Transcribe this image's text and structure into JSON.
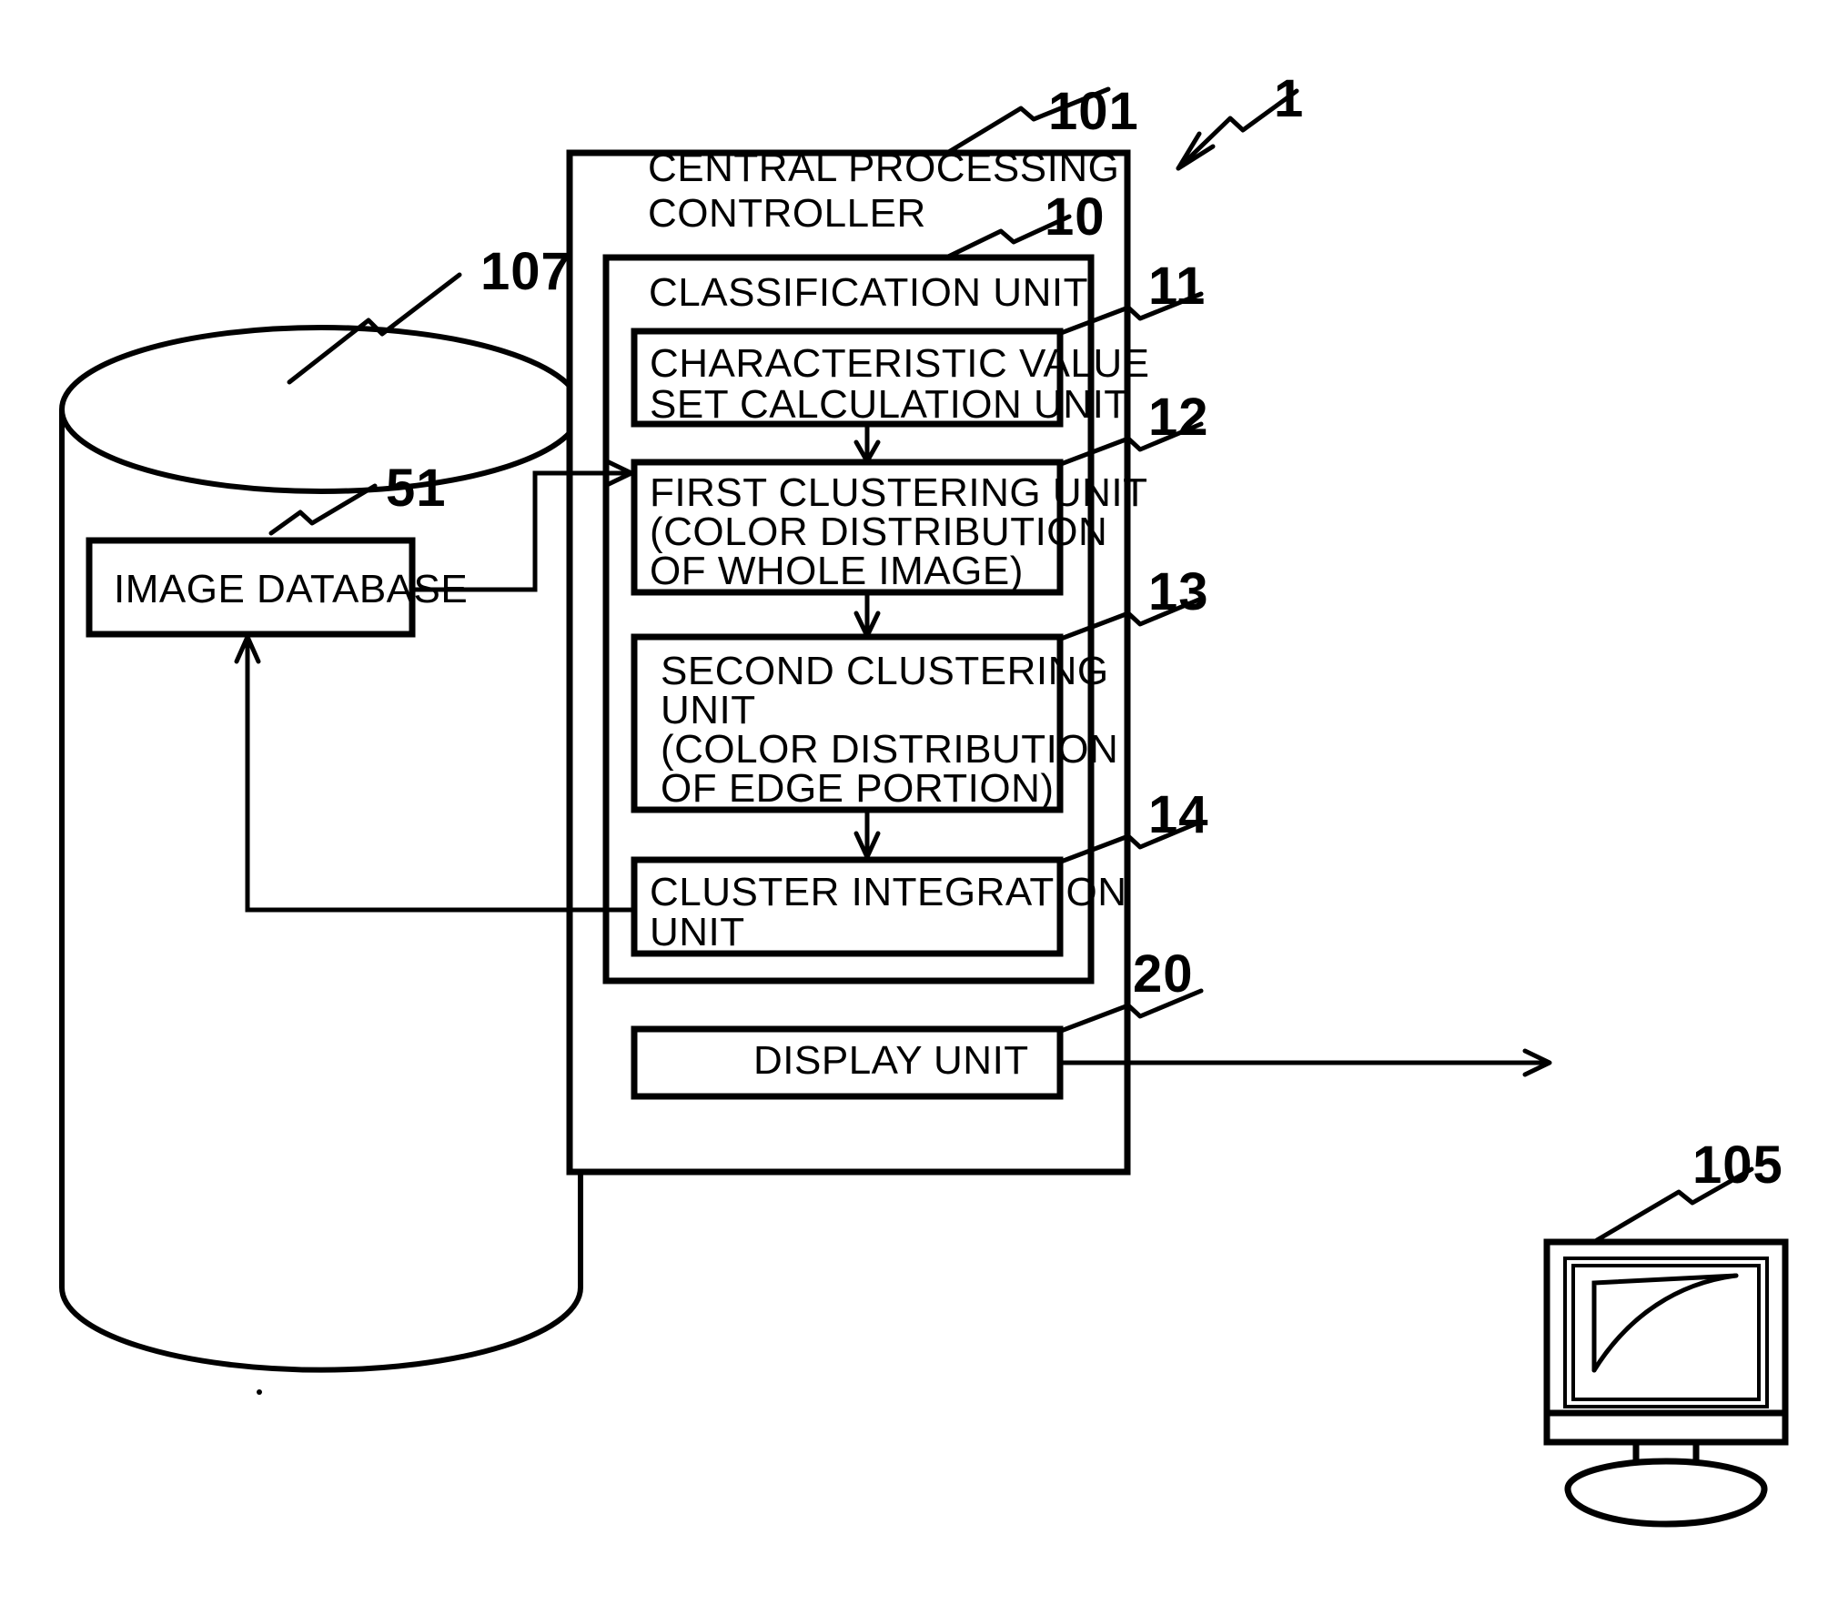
{
  "figure": {
    "type": "patent-block-diagram",
    "system_ref": "1"
  },
  "database": {
    "cylinder_ref": "107",
    "inner_box_ref": "51",
    "inner_box_label": "IMAGE DATABASE"
  },
  "controller": {
    "ref": "101",
    "title_line1": "CENTRAL PROCESSING",
    "title_line2": "CONTROLLER"
  },
  "classification_unit": {
    "ref": "10",
    "label": "CLASSIFICATION UNIT",
    "units": [
      {
        "ref": "11",
        "name": "characteristic-value-set-calculation-unit",
        "lines": [
          "CHARACTERISTIC VALUE",
          "SET CALCULATION UNIT"
        ]
      },
      {
        "ref": "12",
        "name": "first-clustering-unit",
        "lines": [
          "FIRST CLUSTERING UNIT",
          "(COLOR DISTRIBUTION",
          "OF WHOLE IMAGE)"
        ]
      },
      {
        "ref": "13",
        "name": "second-clustering-unit",
        "lines": [
          "SECOND CLUSTERING",
          "UNIT",
          "(COLOR DISTRIBUTION",
          "OF EDGE PORTION)"
        ]
      },
      {
        "ref": "14",
        "name": "cluster-integration-unit",
        "lines": [
          "CLUSTER INTEGRATION",
          "UNIT"
        ]
      }
    ]
  },
  "display_unit": {
    "ref": "20",
    "label": "DISPLAY UNIT"
  },
  "monitor": {
    "ref": "105"
  },
  "colors": {
    "ink": "#000000",
    "paper": "#ffffff"
  }
}
